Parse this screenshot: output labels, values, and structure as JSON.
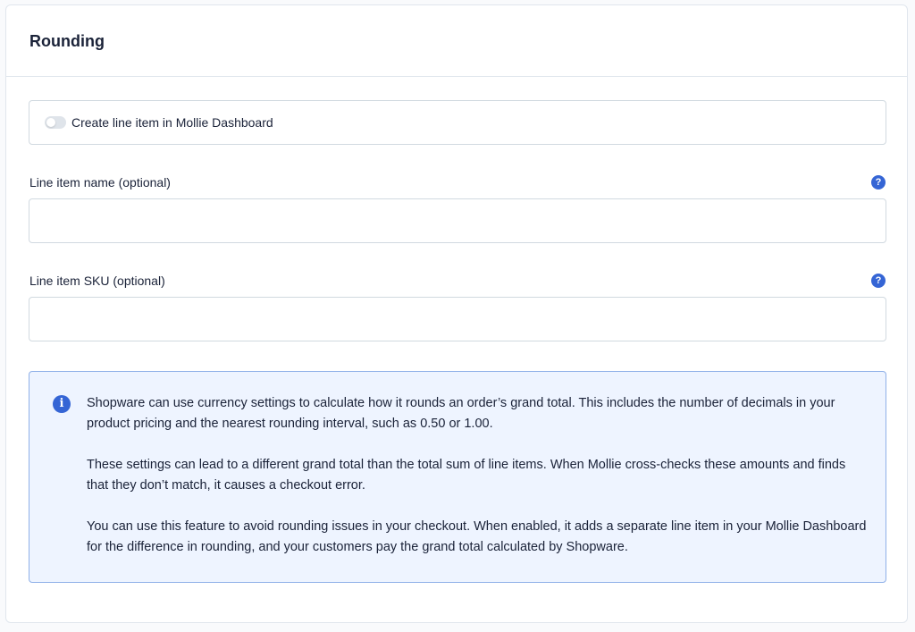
{
  "card": {
    "title": "Rounding"
  },
  "toggle": {
    "label": "Create line item in Mollie Dashboard",
    "enabled": false
  },
  "fields": {
    "name": {
      "label": "Line item name (optional)",
      "value": "",
      "help_icon": "question-icon"
    },
    "sku": {
      "label": "Line item SKU (optional)",
      "value": "",
      "help_icon": "question-icon"
    }
  },
  "info": {
    "icon": "info-icon",
    "paragraphs": [
      "Shopware can use currency settings to calculate how it rounds an order’s grand total. This includes the number of decimals in your product pricing and the nearest rounding interval, such as 0.50 or 1.00.",
      "These settings can lead to a different grand total than the total sum of line items. When Mollie cross-checks these amounts and finds that they don’t match, it causes a checkout error.",
      "You can use this feature to avoid rounding issues in your checkout. When enabled, it adds a separate line item in your Mollie Dashboard for the difference in rounding, and your customers pay the grand total calculated by Shopware."
    ]
  },
  "colors": {
    "accent": "#3565d5",
    "info_background": "#eef4ff",
    "info_border": "#8fb0e8",
    "border": "#d1d9e0"
  }
}
